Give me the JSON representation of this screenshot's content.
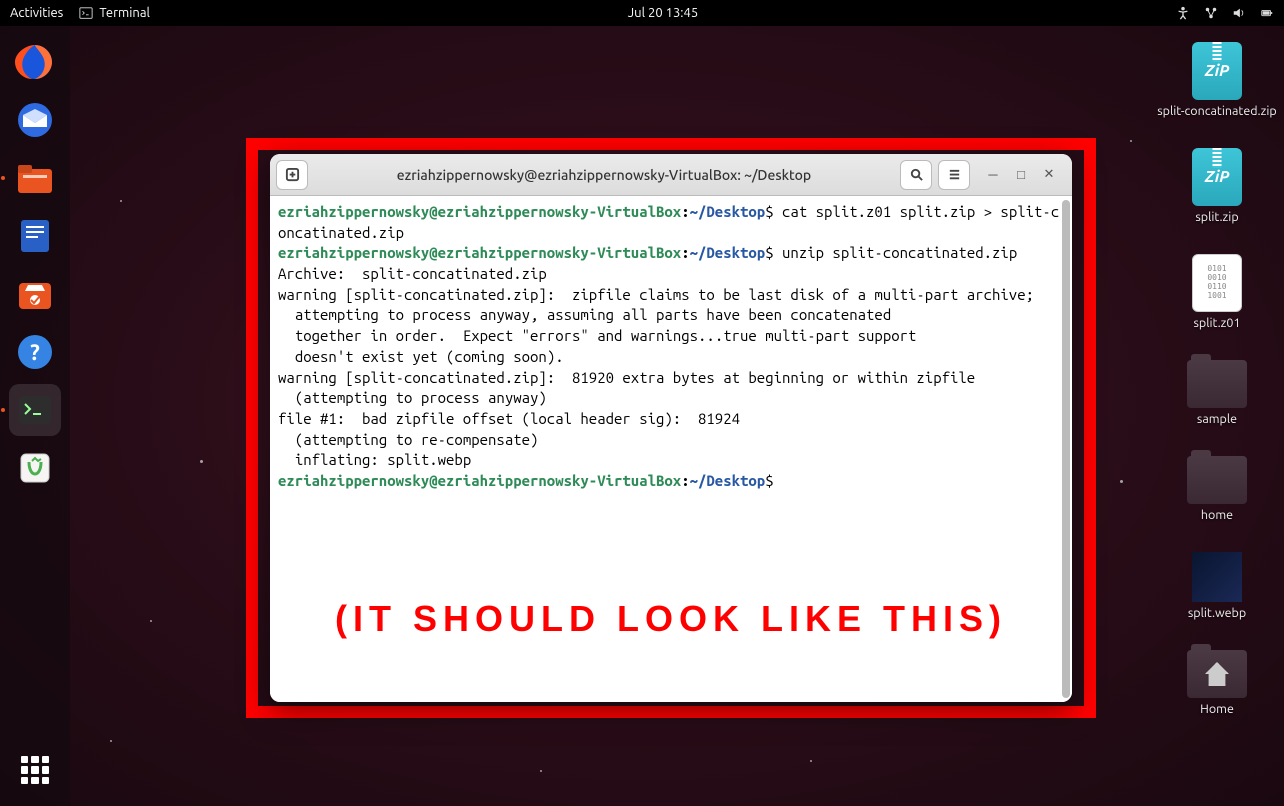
{
  "topbar": {
    "activities": "Activities",
    "app_name": "Terminal",
    "clock": "Jul 20  13:45"
  },
  "dock": {
    "items": [
      {
        "name": "firefox",
        "color": "#ff7139"
      },
      {
        "name": "thunderbird",
        "color": "#2f6be0"
      },
      {
        "name": "files",
        "color": "#e95420",
        "marked": true
      },
      {
        "name": "writer",
        "color": "#2860c5"
      },
      {
        "name": "software",
        "color": "#e95420"
      },
      {
        "name": "help",
        "color": "#3584e4"
      },
      {
        "name": "terminal",
        "color": "#2d2d2d",
        "active": true,
        "marked": true
      },
      {
        "name": "trash",
        "color": "#f6f5f4"
      }
    ]
  },
  "desktop": {
    "items": [
      {
        "type": "zip",
        "label": "split-concatinated.zip"
      },
      {
        "type": "zip",
        "label": "split.zip"
      },
      {
        "type": "txt",
        "label": "split.z01",
        "content": "0101\n0010\n0110\n1001"
      },
      {
        "type": "folder",
        "label": "sample"
      },
      {
        "type": "folder",
        "label": "home"
      },
      {
        "type": "webp",
        "label": "split.webp"
      },
      {
        "type": "folder-home",
        "label": "Home"
      }
    ]
  },
  "terminal": {
    "title": "ezriahzippernowsky@ezriahzippernowsky-VirtualBox: ~/Desktop",
    "prompt": {
      "user": "ezriahzippernowsky",
      "host": "ezriahzippernowsky-VirtualBox",
      "path": "~/Desktop",
      "sigil": "$"
    },
    "lines": [
      {
        "t": "prompt",
        "cmd": "cat split.z01 split.zip > split-concatinated.zip"
      },
      {
        "t": "prompt",
        "cmd": "unzip split-concatinated.zip"
      },
      {
        "t": "out",
        "text": "Archive:  split-concatinated.zip"
      },
      {
        "t": "out",
        "text": "warning [split-concatinated.zip]:  zipfile claims to be last disk of a multi-part archive;"
      },
      {
        "t": "out",
        "text": "  attempting to process anyway, assuming all parts have been concatenated"
      },
      {
        "t": "out",
        "text": "  together in order.  Expect \"errors\" and warnings...true multi-part support"
      },
      {
        "t": "out",
        "text": "  doesn't exist yet (coming soon)."
      },
      {
        "t": "out",
        "text": "warning [split-concatinated.zip]:  81920 extra bytes at beginning or within zipfile"
      },
      {
        "t": "out",
        "text": "  (attempting to process anyway)"
      },
      {
        "t": "out",
        "text": "file #1:  bad zipfile offset (local header sig):  81924"
      },
      {
        "t": "out",
        "text": "  (attempting to re-compensate)"
      },
      {
        "t": "out",
        "text": "  inflating: split.webp"
      },
      {
        "t": "prompt",
        "cmd": ""
      }
    ]
  },
  "annotation": "(IT SHOULD LOOK LIKE THIS)"
}
